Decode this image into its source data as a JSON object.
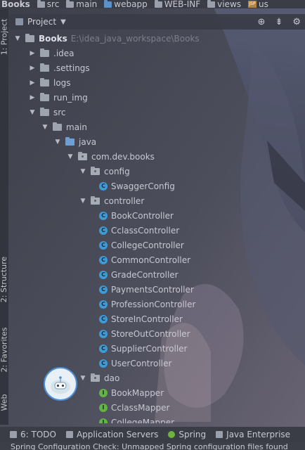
{
  "breadcrumb": [
    "Books",
    "src",
    "main",
    "webapp",
    "WEB-INF",
    "views",
    "us"
  ],
  "left_strip": {
    "project": "1: Project",
    "structure": "2: Structure",
    "favorites": "2: Favorites",
    "web": "Web"
  },
  "project_header": {
    "title": "Project"
  },
  "tree": {
    "root": {
      "label": "Books",
      "path": "E:\\idea_java_workspace\\Books"
    },
    "items": [
      ".idea",
      ".settings",
      "logs",
      "run_img",
      "src",
      "main",
      "java",
      "com.dev.books",
      "config",
      "SwaggerConfig",
      "controller",
      "BookController",
      "CclassController",
      "CollegeController",
      "CommonController",
      "GradeController",
      "PaymentsController",
      "ProfessionController",
      "StoreInController",
      "StoreOutController",
      "SupplierController",
      "UserController",
      "dao",
      "BookMapper",
      "CclassMapper",
      "CollegeMapper"
    ]
  },
  "tool_windows": [
    "6: TODO",
    "Application Servers",
    "Spring",
    "Java Enterprise"
  ],
  "status": "Spring Configuration Check: Unmapped Spring configuration files found",
  "colors": {
    "accent_blue": "#3f9bd5",
    "interface_green": "#62b543",
    "bar_bg": "#3a3c46"
  }
}
